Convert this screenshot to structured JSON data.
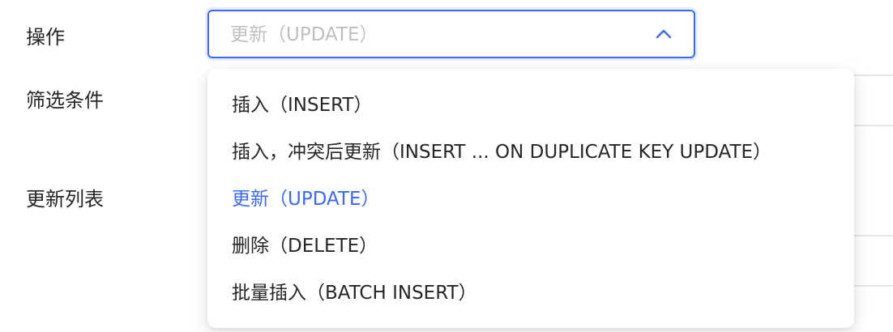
{
  "form": {
    "labels": {
      "operation": "操作",
      "filter": "筛选条件",
      "update_list": "更新列表"
    }
  },
  "select": {
    "value": "更新（UPDATE）",
    "icon": "chevron-up-icon"
  },
  "dropdown": {
    "options": [
      {
        "label": "插入（INSERT）",
        "selected": false
      },
      {
        "label": "插入，冲突后更新（INSERT ... ON DUPLICATE KEY UPDATE）",
        "selected": false
      },
      {
        "label": "更新（UPDATE）",
        "selected": true
      },
      {
        "label": "删除（DELETE）",
        "selected": false
      },
      {
        "label": "批量插入（BATCH INSERT）",
        "selected": false
      }
    ]
  },
  "colors": {
    "accent": "#3b68ff",
    "text": "#262626",
    "placeholder": "#bfbfbf",
    "divider": "#e6e6e6"
  }
}
